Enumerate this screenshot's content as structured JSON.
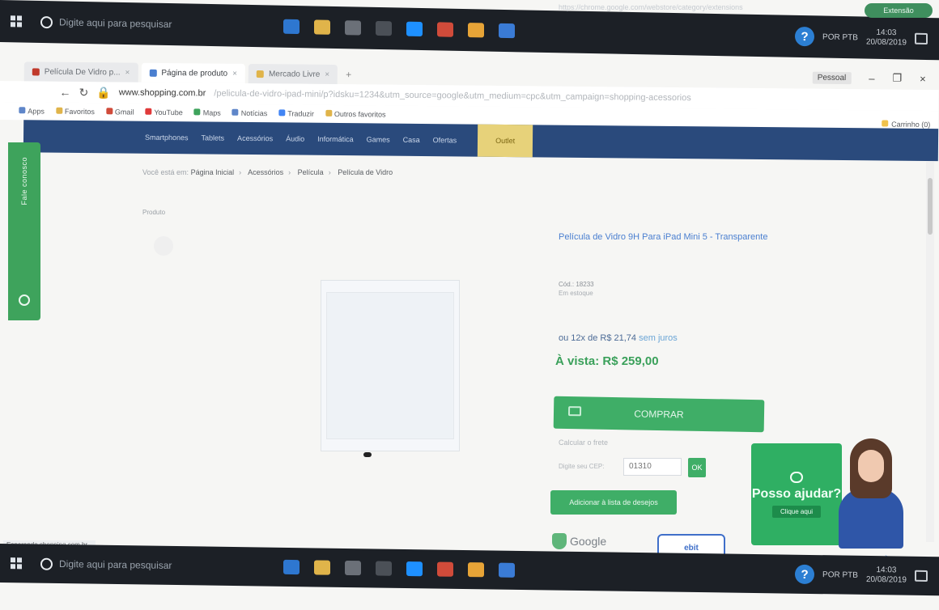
{
  "taskbar": {
    "search_placeholder": "Digite aqui para pesquisar",
    "time": "14:03",
    "date": "20/08/2019",
    "lang": "POR PTB"
  },
  "overlay": {
    "notification_text": "https://chrome.google.com/webstore/category/extensions",
    "extension_badge": "Extensão"
  },
  "browser": {
    "tabs": [
      {
        "label": "Película De Vidro p..."
      },
      {
        "label": "Página de produto"
      },
      {
        "label": "Mercado Livre"
      }
    ],
    "profile": "Pessoal",
    "url": "www.shopping.com.br",
    "url_rest": "/pelicula-de-vidro-ipad-mini/p?idsku=1234&utm_source=google&utm_medium=cpc&utm_campaign=shopping-acessorios",
    "bookmarks": [
      "Apps",
      "Favoritos",
      "Gmail",
      "YouTube",
      "Maps",
      "Notícias",
      "Traduzir",
      "Outros favoritos"
    ]
  },
  "site": {
    "nav": [
      "Smartphones",
      "Tablets",
      "Acessórios",
      "Áudio",
      "Informática",
      "Games",
      "Casa",
      "Ofertas"
    ],
    "nav_highlight": "Outlet",
    "cart": "Carrinho (0)",
    "side_tab": "Fale conosco"
  },
  "breadcrumb": [
    "Você está em:",
    "Página Inicial",
    "Acessórios",
    "Película",
    "Película de Vidro"
  ],
  "product": {
    "label": "Produto",
    "title": "Película de Vidro 9H Para iPad Mini 5 - Transparente",
    "code": "Cód.: 18233",
    "stock": "Em estoque",
    "installment_label": "ou 12x de",
    "installment_value": "R$ 21,74",
    "installment_free": "sem juros",
    "cash_label": "À vista:",
    "cash_value": "R$ 259,00",
    "buy_label": "COMPRAR",
    "shipping_title": "Calcular o frete",
    "cep_label": "Digite seu CEP:",
    "cep_value": "01310",
    "ok_label": "OK",
    "wishlist_label": "Adicionar à lista de desejos"
  },
  "badges": {
    "google": "Google",
    "ebit": "ebit"
  },
  "help_widget": {
    "title": "Posso ajudar?",
    "cta": "Clique aqui"
  },
  "status_bar": "Esperando shopping.com.br..."
}
